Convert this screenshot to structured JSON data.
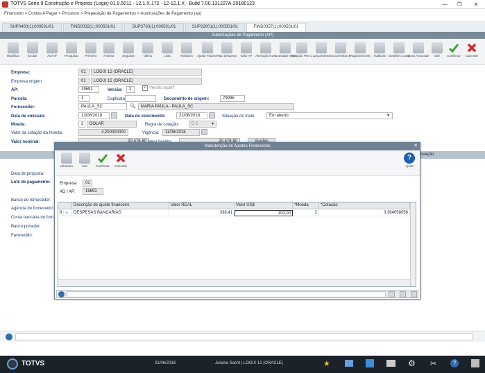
{
  "window": {
    "title": "TOTVS Série 9 Construção e Projetos (Logix) 01.9.5011 - 12.1.X.172 - 12-12.1.X - Build 7.00.131227A-20180123",
    "controls": [
      "—",
      "❐",
      "✕"
    ]
  },
  "breadcrumb": "Financeiro > Contas A Pagar > Processo > Preparação de Pagamentos > Autorizações de Pagamento (ap)",
  "tabs": [
    {
      "label": "SUP0460(1):000501/01"
    },
    {
      "label": "FIND0032(1):000501/01"
    },
    {
      "label": "SUP3760(1):000501/01"
    },
    {
      "label": "SUP22001(1):000501/01"
    },
    {
      "label": "FIND0057(1):000501/01"
    }
  ],
  "form_title": "Autorizações de Pagamento (AP)",
  "toolbar": [
    {
      "label": "Modificar",
      "icon": "edit-icon"
    },
    {
      "label": "Excluir",
      "icon": "delete-icon"
    },
    {
      "label": "AD/AP",
      "icon": "document-icon"
    },
    {
      "label": "Pesquisar",
      "icon": "search-icon"
    },
    {
      "label": "Primeiro",
      "icon": "first-icon"
    },
    {
      "label": "Anterior",
      "icon": "previous-icon"
    },
    {
      "label": "Seguinte",
      "icon": "next-icon"
    },
    {
      "label": "Último",
      "icon": "last-icon"
    },
    {
      "label": "Lista",
      "icon": "list-icon"
    },
    {
      "label": "Relatório",
      "icon": "report-icon"
    },
    {
      "label": "Ajuste Financeiro",
      "icon": "adjust-icon"
    },
    {
      "label": "Tipo Despesa",
      "icon": "expense-icon"
    },
    {
      "label": "Valor AP",
      "icon": "value-icon"
    },
    {
      "label": "Alteração Ícone",
      "icon": "change-icon"
    },
    {
      "label": "Consultar Impostos",
      "icon": "taxes-icon"
    },
    {
      "label": "Relação PIS COFINS/CSLL",
      "icon": "pis-icon"
    },
    {
      "label": "Lançamento",
      "icon": "entry-icon"
    },
    {
      "label": "Documentos & Títulos",
      "icon": "titles-icon"
    },
    {
      "label": "Pagamento Eletrônico",
      "icon": "payment-icon"
    },
    {
      "label": "Auditoria",
      "icon": "audit-icon"
    },
    {
      "label": "Detalhes Cotação",
      "icon": "quote-icon"
    },
    {
      "label": "Docs Associados",
      "icon": "docs-icon"
    },
    {
      "label": "Sair",
      "icon": "exit-icon"
    },
    {
      "label": "Confirmar",
      "icon": "check-icon"
    },
    {
      "label": "Cancelar",
      "icon": "cancel-icon"
    }
  ],
  "form": {
    "empresa_label": "Empresa:",
    "empresa_code": "01",
    "empresa_name": "LOGIX 12 (ORACLE)",
    "empresa_origem_label": "Empresa origem:",
    "empresa_origem_code": "01",
    "empresa_origem_name": "LOGIX 12 (ORACLE)",
    "ap_label": "AP:",
    "ap_value": "19691",
    "versao_label": "Versão:",
    "versao_value": "2",
    "versao_atual_label": "Versão atual?",
    "parcela_label": "Parcela:",
    "parcela_value": "1",
    "duplicata_label": "Duplicata:",
    "doc_origem_label": "Documento de origem:",
    "doc_origem_value": "79996",
    "fornecedor_label": "Fornecedor:",
    "fornecedor_code": "PAULA_SC",
    "fornecedor_name": "MARIA PAULA - PAULA_SC",
    "data_emissao_label": "Data de emissão:",
    "data_emissao_value": "13/06/2018",
    "data_venc_label": "Data de vencimento:",
    "data_venc_value": "22/06/2018",
    "situacao_label": "Situação do título:",
    "situacao_value": "Em aberto",
    "moeda_label": "Moeda:",
    "moeda_code": "2",
    "moeda_name": "DOLAR",
    "regra_label": "Regra de cotação:",
    "regra_value": "D-1",
    "cotacao_label": "Valor da cotação da moeda:",
    "cotacao_value": "4,200000000",
    "vigencia_label": "Vigência:",
    "vigencia_value": "11/06/2018",
    "nominal_label": "Valor nominal:",
    "nominal_value": "20.476,80",
    "liquido_label": "Valor líquido:",
    "liquido_value": "20.476,80",
    "ajustes_label": "Ajustes",
    "aprovacao_label": "ovação",
    "proposta_label": "Data de proposta:",
    "lote_label": "Lote de pagamento:",
    "banco_label": "Banco do fornecedor:",
    "agencia_label": "Agência do fornecedor:",
    "conta_label": "Conta bancária do forn",
    "portador_label": "Banco portador:",
    "favorecido_label": "Favorecido:"
  },
  "modal": {
    "title": "Manutenção de Ajustes Financeiros",
    "toolbar": [
      {
        "label": "Adiantam.",
        "icon": "advance-icon"
      },
      {
        "label": "Sair",
        "icon": "exit-icon"
      },
      {
        "label": "Confirmar",
        "icon": "check-icon"
      },
      {
        "label": "Cancelar",
        "icon": "cancel-icon"
      }
    ],
    "help_label": "Ajuda",
    "empresa_label": "Empresa:",
    "empresa_value": "01",
    "adap_label": "AD / AP:",
    "adap_value": "19691",
    "columns": [
      "Descrição do ajuste financeiro",
      "Valor REAL",
      "Valor US$",
      "*Moeda",
      "*Cotação"
    ],
    "rows": [
      {
        "num": "9",
        "descricao": "DESPESAS BANCARIAS",
        "valor_real": "338,41",
        "valor_usd": "100,00",
        "moeda": "2",
        "cotacao": "3,384058056"
      }
    ]
  },
  "taskbar": {
    "brand": "TOTVS",
    "date": "21/06/2018",
    "user": "Juliana Sacht | LOGIX 12 (ORACLE)"
  }
}
